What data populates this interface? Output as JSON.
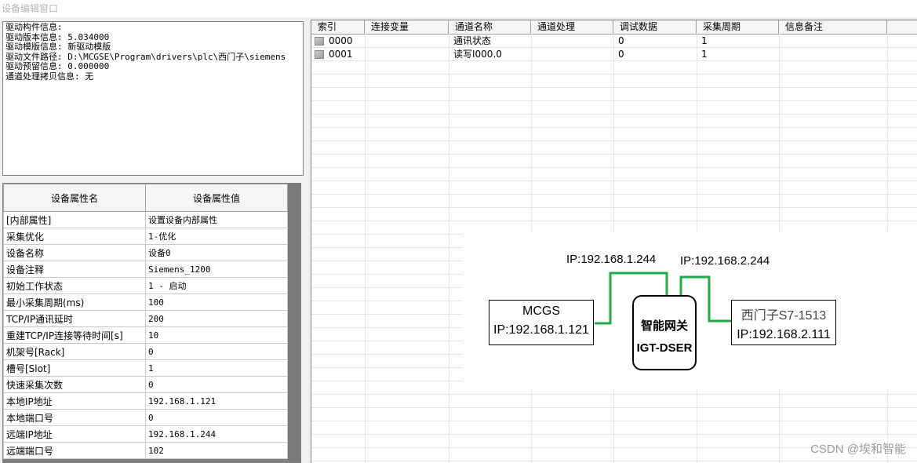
{
  "window": {
    "title": "设备编辑窗口"
  },
  "driver_info": {
    "lines": [
      "驱动构件信息:",
      "驱动版本信息: 5.034000",
      "驱动模版信息: 新驱动模版",
      "驱动文件路径: D:\\MCGSE\\Program\\drivers\\plc\\西门子\\siemens",
      "驱动预留信息: 0.000000",
      "通道处理拷贝信息: 无"
    ]
  },
  "properties": {
    "header": {
      "name": "设备属性名",
      "value": "设备属性值"
    },
    "rows": [
      {
        "name": "[内部属性]",
        "value": "设置设备内部属性"
      },
      {
        "name": "采集优化",
        "value": "1-优化"
      },
      {
        "name": "设备名称",
        "value": "设备0"
      },
      {
        "name": "设备注释",
        "value": "Siemens_1200"
      },
      {
        "name": "初始工作状态",
        "value": "1 - 启动"
      },
      {
        "name": "最小采集周期(ms)",
        "value": "100"
      },
      {
        "name": "TCP/IP通讯延时",
        "value": "200"
      },
      {
        "name": "重建TCP/IP连接等待时间[s]",
        "value": "10"
      },
      {
        "name": "机架号[Rack]",
        "value": "0"
      },
      {
        "name": "槽号[Slot]",
        "value": "1"
      },
      {
        "name": "快速采集次数",
        "value": "0"
      },
      {
        "name": "本地IP地址",
        "value": "192.168.1.121"
      },
      {
        "name": "本地端口号",
        "value": "0"
      },
      {
        "name": "远端IP地址",
        "value": "192.168.1.244"
      },
      {
        "name": "远端端口号",
        "value": "102"
      }
    ]
  },
  "channels": {
    "columns": [
      "索引",
      "连接变量",
      "通道名称",
      "通道处理",
      "调试数据",
      "采集周期",
      "信息备注"
    ],
    "rows": [
      {
        "index": "0000",
        "variable": "",
        "name": "通讯状态",
        "process": "",
        "debug": "0",
        "period": "1",
        "note": ""
      },
      {
        "index": "0001",
        "variable": "",
        "name": "读写I000.0",
        "process": "",
        "debug": "0",
        "period": "1",
        "note": ""
      }
    ]
  },
  "diagram": {
    "ip_left": "IP:192.168.1.244",
    "ip_right": "IP:192.168.2.244",
    "mcgs_name": "MCGS",
    "mcgs_ip": "IP:192.168.1.121",
    "gateway_name": "智能网关",
    "gateway_model": "IGT-DSER",
    "plc_name": "西门子S7-1513",
    "plc_ip": "IP:192.168.2.111",
    "link_color": "#22aa44"
  },
  "watermark": "CSDN @埃和智能"
}
